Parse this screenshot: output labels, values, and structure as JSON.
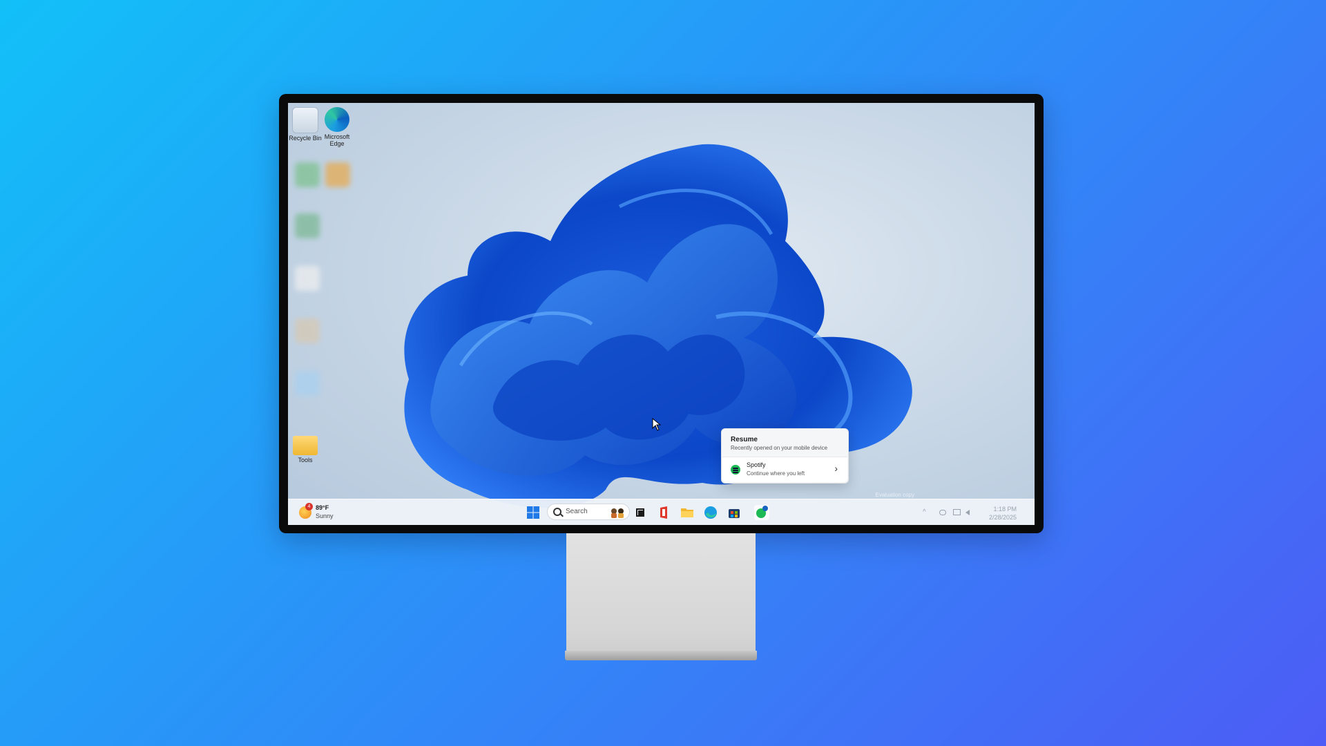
{
  "desktop": {
    "icons": [
      {
        "label": "Recycle Bin",
        "icon": "recycle-bin-icon"
      },
      {
        "label": "Microsoft Edge",
        "icon": "edge-icon"
      },
      {
        "label": "Tools",
        "icon": "folder-icon"
      }
    ],
    "watermark": "Evaluation copy"
  },
  "popup": {
    "title": "Resume",
    "subtitle": "Recently opened on your mobile device",
    "app_name": "Spotify",
    "app_desc": "Continue where you left",
    "chevron": "›"
  },
  "taskbar": {
    "weather": {
      "temp": "89°F",
      "condition": "Sunny",
      "badge": "4"
    },
    "search_label": "Search",
    "pinned": [
      {
        "name": "start-button",
        "icon": "windows-logo-icon"
      },
      {
        "name": "taskview-button",
        "icon": "taskview-icon"
      },
      {
        "name": "office-button",
        "icon": "office-icon"
      },
      {
        "name": "file-explorer-button",
        "icon": "folder-icon"
      },
      {
        "name": "edge-button",
        "icon": "edge-icon"
      },
      {
        "name": "store-button",
        "icon": "store-icon"
      },
      {
        "name": "phone-link-button",
        "icon": "phone-link-icon"
      }
    ],
    "tray_chevron": "^",
    "clock_time": "1:18 PM",
    "clock_date": "2/28/2025"
  },
  "colors": {
    "accent": "#0a5fd8",
    "spotify": "#1db954"
  }
}
